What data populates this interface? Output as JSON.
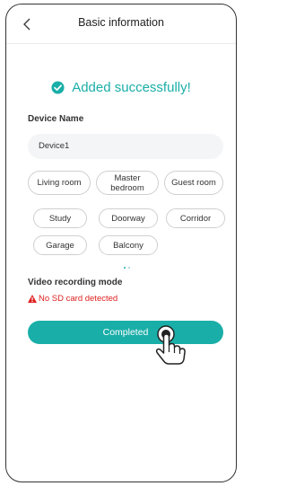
{
  "header": {
    "title": "Basic information"
  },
  "success": {
    "message": "Added successfully!"
  },
  "device_name": {
    "label": "Device Name",
    "value": "Device1"
  },
  "rooms": [
    "Living room",
    "Master bedroom",
    "Guest room",
    "Study",
    "Doorway",
    "Corridor",
    "Garage",
    "Balcony"
  ],
  "video": {
    "label": "Video recording mode",
    "error": "No SD card detected"
  },
  "actions": {
    "completed_label": "Completed"
  },
  "colors": {
    "accent": "#1aaea8",
    "error": "#e02020"
  }
}
